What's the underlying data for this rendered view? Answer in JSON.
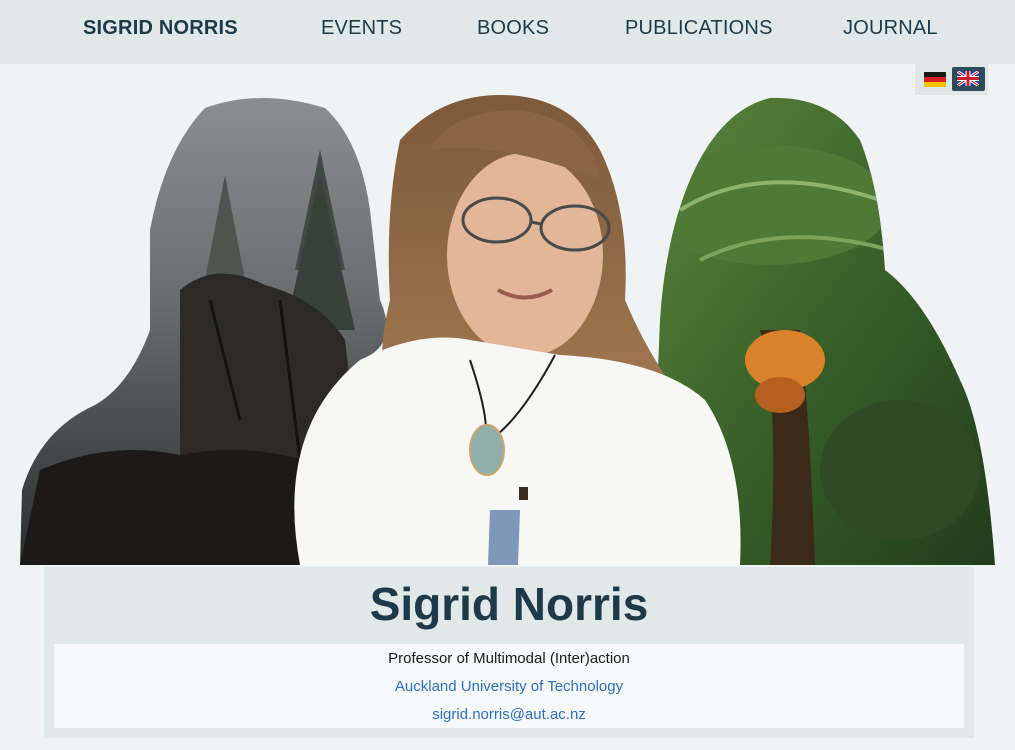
{
  "nav": {
    "brand": "SIGRID NORRIS",
    "items": [
      {
        "label": "EVENTS"
      },
      {
        "label": "BOOKS"
      },
      {
        "label": "PUBLICATIONS"
      },
      {
        "label": "JOURNAL"
      }
    ]
  },
  "lang": {
    "options": [
      {
        "icon": "german-flag-icon",
        "selected": false
      },
      {
        "icon": "uk-flag-icon",
        "selected": true
      }
    ]
  },
  "profile": {
    "name": "Sigrid Norris",
    "title": "Professor of Multimodal (Inter)action",
    "institution": "Auckland University of Technology",
    "email": "sigrid.norris@aut.ac.nz"
  },
  "colors": {
    "accent": "#1e3a48",
    "link": "#2f6fb8",
    "nav_bg": "#e1e8ea",
    "page_bg": "#eff3f4"
  }
}
